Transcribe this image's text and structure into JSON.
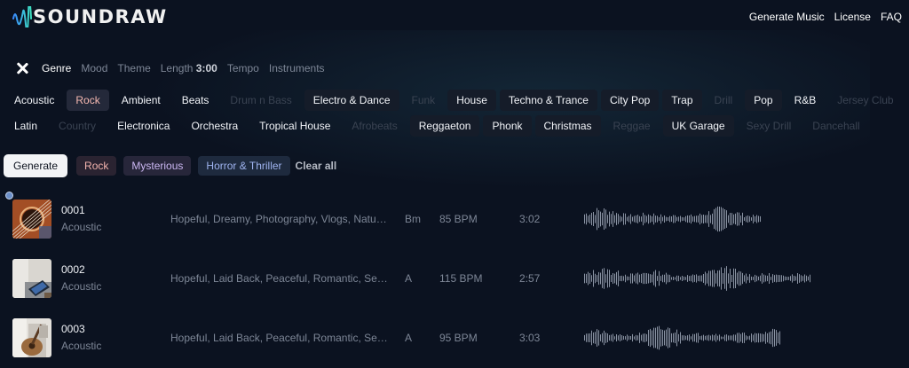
{
  "app": {
    "brand": "SOUNDRAW",
    "nav": [
      "Generate Music",
      "License",
      "FAQ"
    ]
  },
  "filters": {
    "tabs": [
      {
        "label": "Genre",
        "active": true
      },
      {
        "label": "Mood"
      },
      {
        "label": "Theme"
      },
      {
        "label": "Length",
        "value": "3:00"
      },
      {
        "label": "Tempo"
      },
      {
        "label": "Instruments"
      }
    ]
  },
  "genres": {
    "row1": [
      {
        "label": "Acoustic",
        "state": "plain"
      },
      {
        "label": "Rock",
        "state": "selected"
      },
      {
        "label": "Ambient",
        "state": "plain"
      },
      {
        "label": "Beats",
        "state": "plain"
      },
      {
        "label": "Drum n Bass",
        "state": "dim"
      },
      {
        "label": "Electro & Dance",
        "state": "box"
      },
      {
        "label": "Funk",
        "state": "dim"
      },
      {
        "label": "House",
        "state": "box"
      },
      {
        "label": "Techno & Trance",
        "state": "box"
      },
      {
        "label": "City Pop",
        "state": "box"
      },
      {
        "label": "Trap",
        "state": "box"
      },
      {
        "label": "Drill",
        "state": "dim"
      },
      {
        "label": "Pop",
        "state": "box"
      },
      {
        "label": "R&B",
        "state": "plain"
      },
      {
        "label": "Jersey Club",
        "state": "dim"
      }
    ],
    "row2": [
      {
        "label": "Latin",
        "state": "plain"
      },
      {
        "label": "Country",
        "state": "dim"
      },
      {
        "label": "Electronica",
        "state": "plain"
      },
      {
        "label": "Orchestra",
        "state": "plain"
      },
      {
        "label": "Tropical House",
        "state": "plain"
      },
      {
        "label": "Afrobeats",
        "state": "dim"
      },
      {
        "label": "Reggaeton",
        "state": "box"
      },
      {
        "label": "Phonk",
        "state": "box"
      },
      {
        "label": "Christmas",
        "state": "box"
      },
      {
        "label": "Reggae",
        "state": "dim"
      },
      {
        "label": "UK Garage",
        "state": "box"
      },
      {
        "label": "Sexy Drill",
        "state": "dim"
      },
      {
        "label": "Dancehall",
        "state": "dim"
      }
    ]
  },
  "actions": {
    "generate": "Generate",
    "active_tags": [
      "Rock",
      "Mysterious",
      "Horror & Thriller"
    ],
    "clear_all": "Clear all"
  },
  "tracks": [
    {
      "id": "0001",
      "genre": "Acoustic",
      "tags": "Hopeful, Dreamy, Photography, Vlogs, Nature, Travel",
      "key": "Bm",
      "bpm": "85 BPM",
      "length": "3:02",
      "thumb": "guitar-closeup"
    },
    {
      "id": "0002",
      "genre": "Acoustic",
      "tags": "Hopeful, Laid Back, Peaceful, Romantic, Sentimental",
      "key": "A",
      "bpm": "115 BPM",
      "length": "2:57",
      "thumb": "desk-tablet"
    },
    {
      "id": "0003",
      "genre": "Acoustic",
      "tags": "Hopeful, Laid Back, Peaceful, Romantic, Sentimental",
      "key": "A",
      "bpm": "95 BPM",
      "length": "3:03",
      "thumb": "guitar-player"
    }
  ],
  "colors": {
    "background": "#0b1220",
    "chip_box": "#151c29",
    "selected_text": "#f6b9b1",
    "waveform": "#8a93a3"
  }
}
